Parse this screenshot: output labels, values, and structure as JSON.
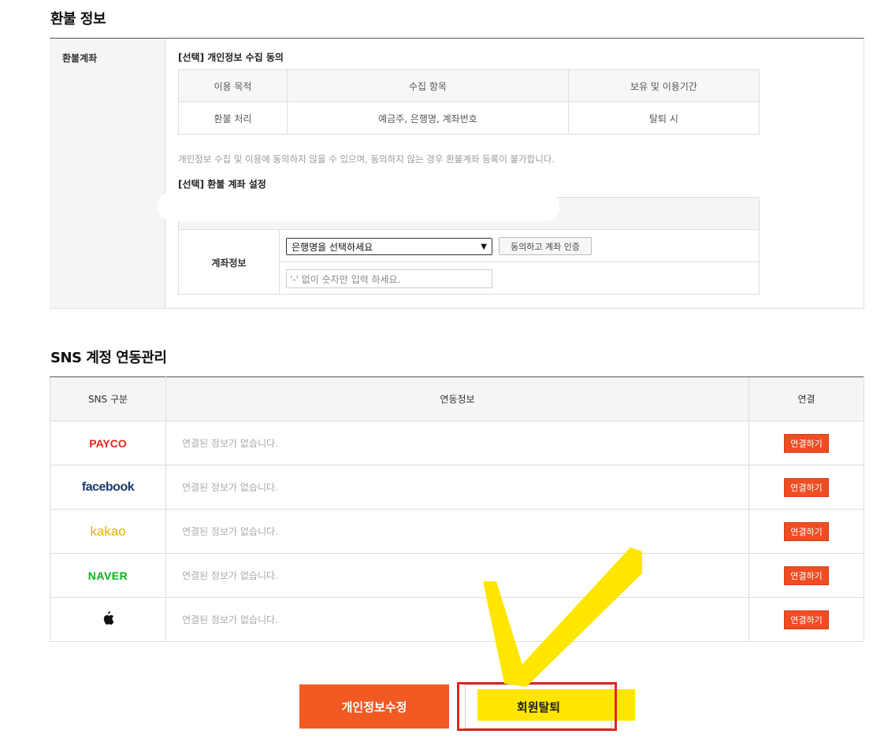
{
  "refund": {
    "section_title": "환불 정보",
    "side_label": "환불계좌",
    "consent_title": "[선택] 개인정보 수집 동의",
    "consent_headers": [
      "이용 목적",
      "수집 항목",
      "보유 및 이용기간"
    ],
    "consent_row": [
      "환불 처리",
      "예금주, 은행명, 계좌번호",
      "탈퇴 시"
    ],
    "consent_note": "개인정보 수집 및 이용에 동의하지 않을 수 있으며, 동의하지 않는 경우 환불계좌 등록이 불가합니다.",
    "account_title": "[선택] 환불 계좌 설정",
    "account_label": "계좌정보",
    "bank_select_value": "은행명을 선택하세요",
    "verify_button": "동의하고 계좌 인증",
    "account_placeholder": "'-' 없이 숫자만 입력 하세요."
  },
  "sns": {
    "section_title": "SNS 계정 연동관리",
    "headers": [
      "SNS 구분",
      "연동정보",
      "연결"
    ],
    "rows": [
      {
        "service": "PAYCO",
        "info": "연결된 정보가 없습니다.",
        "action": "연결하기"
      },
      {
        "service": "facebook",
        "info": "연결된 정보가 없습니다.",
        "action": "연결하기"
      },
      {
        "service": "kakao",
        "info": "연결된 정보가 없습니다.",
        "action": "연결하기"
      },
      {
        "service": "NAVER",
        "info": "연결된 정보가 없습니다.",
        "action": "연결하기"
      },
      {
        "service": "apple-icon",
        "info": "연결된 정보가 없습니다.",
        "action": "연결하기"
      }
    ]
  },
  "buttons": {
    "edit": "개인정보수정",
    "withdraw": "회원탈퇴"
  },
  "colors": {
    "accent_orange": "#f15a23",
    "annotation_yellow": "#ffe600",
    "annotation_red": "#e52222"
  }
}
